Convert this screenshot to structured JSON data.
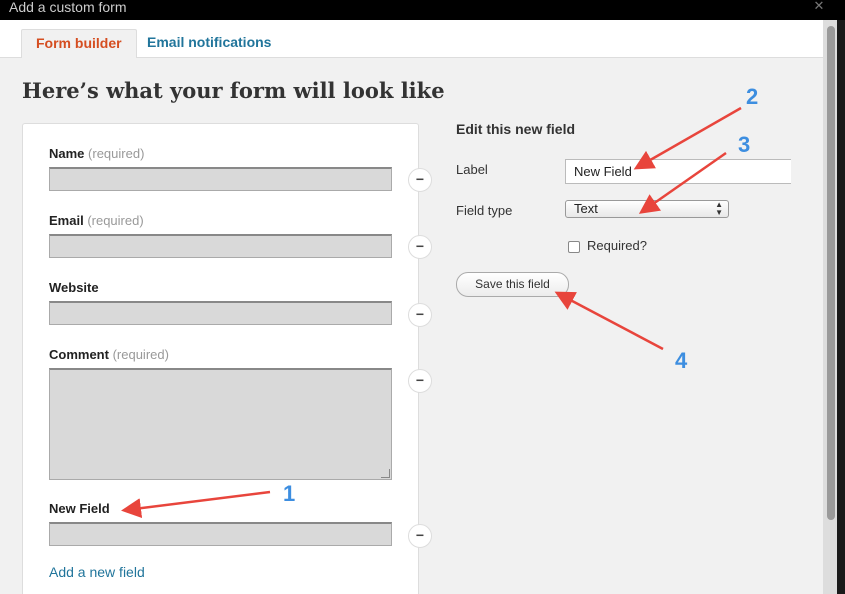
{
  "window": {
    "title": "Add a custom form",
    "close_glyph": "✕"
  },
  "tabs": [
    {
      "label": "Form builder",
      "active": true
    },
    {
      "label": "Email notifications",
      "active": false
    }
  ],
  "heading": "Here’s what your form will look like",
  "preview": {
    "fields": [
      {
        "label": "Name",
        "required_text": "(required)"
      },
      {
        "label": "Email",
        "required_text": "(required)"
      },
      {
        "label": "Website",
        "required_text": ""
      },
      {
        "label": "Comment",
        "required_text": "(required)"
      },
      {
        "label": "New Field",
        "required_text": ""
      }
    ],
    "remove_glyph": "−",
    "add_link": "Add a new field"
  },
  "editor": {
    "title": "Edit this new field",
    "label_caption": "Label",
    "label_value": "New Field",
    "type_caption": "Field type",
    "type_value": "Text",
    "required_label": "Required?",
    "save_label": "Save this field"
  },
  "annotations": [
    "1",
    "2",
    "3",
    "4"
  ],
  "colors": {
    "accent_tab": "#d54e21",
    "link": "#21759b",
    "annotation_arrow": "#e8453c",
    "annotation_number": "#3d8ee0"
  }
}
